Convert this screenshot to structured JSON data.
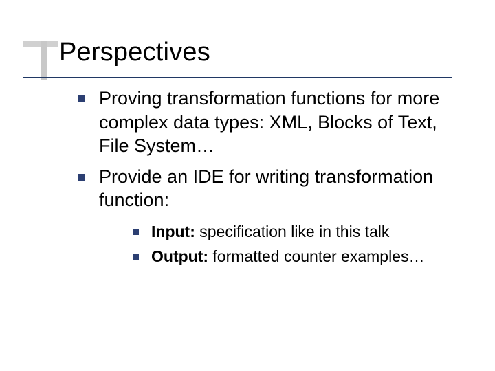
{
  "title": "Perspectives",
  "bullets": [
    {
      "text": "Proving transformation functions for more complex data types: XML, Blocks of Text, File System…"
    },
    {
      "text": "Provide an IDE for writing transformation function:"
    }
  ],
  "sub_bullets": [
    {
      "bold": "Input:",
      "rest": " specification like in this talk"
    },
    {
      "bold": "Output:",
      "rest": " formatted counter examples…"
    }
  ]
}
